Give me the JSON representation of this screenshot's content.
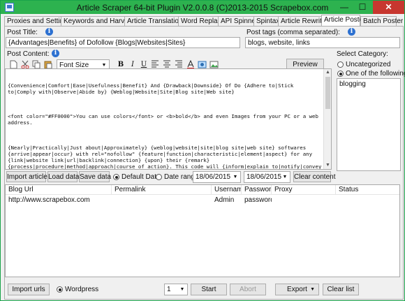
{
  "window": {
    "title": "Article Scraper 64-bit Plugin V2.0.0.8 (C)2013-2015 Scrapebox.com",
    "controls": {
      "minimize": "—",
      "maximize": "☐",
      "close": "✕"
    }
  },
  "tabs": [
    {
      "label": "Proxies and Settings"
    },
    {
      "label": "Keywords and Harvester"
    },
    {
      "label": "Article Translation"
    },
    {
      "label": "Word Replace"
    },
    {
      "label": "API Spinner"
    },
    {
      "label": "Spintax"
    },
    {
      "label": "Article Rewriter"
    },
    {
      "label": "Article Poster"
    },
    {
      "label": "Batch Poster"
    }
  ],
  "post_title": {
    "label": "Post Title:",
    "value": "{Advantages|Benefits} of Dofollow {Blogs|Websites|Sites}"
  },
  "post_tags": {
    "label": "Post tags (comma separated):",
    "value": "blogs, website, links"
  },
  "post_content": {
    "label": "Post Content:",
    "font_size": "Font Size",
    "preview_label": "Preview",
    "paragraphs": [
      "{Convenience|Comfort|Ease|Usefulness|Benefit} And {Drawback|Downside} Of Do {Adhere to|Stick to|Comply with|Observe|Abide by} {Weblog|Website|Site|Blog site|Web site}",
      "<font color=\"#FF0000\">You can use colors</font> or <b>bold</b> and even Images from your PC or a web address.",
      "{Nearly|Practically|Just about|Approximately} {weblog|website|site|blog site|web site} softwares {arrive|appear|occur} with rel=\"nofollow\" {feature|function|characteristic|element|aspect} for any {link|website link|url|backlink|connection} {upon} their {remark} {process|procedure|method|approach|course of action}. This code will {inform|explain to|notify|convey to} google and {an additional|yet another|one more|a different|a further} {look|appear|seem|glance|glimpse} {motor} {towards|in the direction of|in direction of|toward} {forget|neglect|overlook|fail to remember|forget about} {link|website link|url|backlink|connection} {upon} the {remark} {process|procedure|method|approach|course of action}. It {indicates|implies|signifies|suggests|usually means} if {yourself|your self|oneself|by yourself|on your own} {place|location|spot|area|position} a {link|hyperlink|website"
    ]
  },
  "category": {
    "label": "Select Category:",
    "uncategorized": "Uncategorized",
    "one_of_following": "One of the following",
    "list": [
      "blogging"
    ]
  },
  "actions_row": {
    "import_article": "Import article",
    "load_data": "Load data",
    "save_data": "Save data",
    "default_date": "Default Date",
    "date_range": "Date range",
    "date_from": "18/06/2015",
    "date_to": "18/06/2015",
    "clear_content": "Clear content"
  },
  "grid": {
    "columns": [
      "Blog Url",
      "Permalink",
      "Username",
      "Password",
      "Proxy",
      "Status"
    ],
    "rows": [
      [
        "http://www.scrapebox.com",
        "",
        "Admin",
        "password",
        "",
        ""
      ]
    ]
  },
  "footer": {
    "import_urls": "Import urls",
    "platform": "Wordpress",
    "threads": "1",
    "start": "Start",
    "abort": "Abort",
    "export": "Export",
    "clear_list": "Clear list"
  }
}
